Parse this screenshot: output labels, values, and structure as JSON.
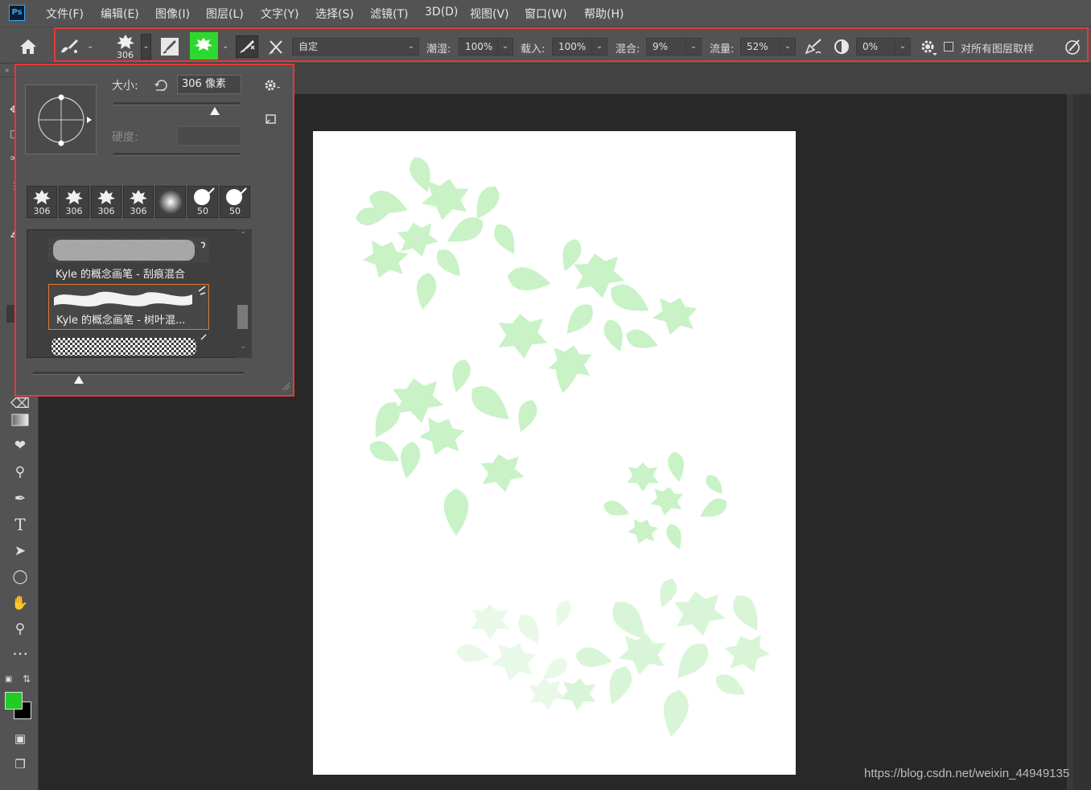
{
  "app": {
    "logo": "Ps"
  },
  "menu": [
    "文件(F)",
    "编辑(E)",
    "图像(I)",
    "图层(L)",
    "文字(Y)",
    "选择(S)",
    "滤镜(T)",
    "3D(D)",
    "视图(V)",
    "窗口(W)",
    "帮助(H)"
  ],
  "options": {
    "brush_size": "306",
    "mode_value": "自定",
    "wet_label": "潮湿:",
    "wet_value": "100%",
    "load_label": "载入:",
    "load_value": "100%",
    "mix_label": "混合:",
    "mix_value": "9%",
    "flow_label": "流量:",
    "flow_value": "52%",
    "angle_value": "0%",
    "sample_all_label": "对所有图层取样",
    "sample_all_checked": false,
    "brush_color": "#2fd82f"
  },
  "brush_panel": {
    "size_label": "大小:",
    "size_value": "306 像素",
    "hardness_label": "硬度:",
    "hardness_value": "",
    "presets": [
      "306",
      "306",
      "306",
      "306",
      "",
      "50",
      "50"
    ],
    "brushes": [
      {
        "name": "Kyle 的概念画笔 - 刮痕混合",
        "selected": false
      },
      {
        "name": "Kyle 的概念画笔 - 树叶混...",
        "selected": true
      },
      {
        "name": "",
        "selected": false
      }
    ]
  },
  "colors": {
    "foreground": "#22cc22",
    "background": "#000000",
    "highlight": "#e53935",
    "leaf": "#c9f2c7"
  },
  "watermark": "https://blog.csdn.net/weixin_44949135"
}
